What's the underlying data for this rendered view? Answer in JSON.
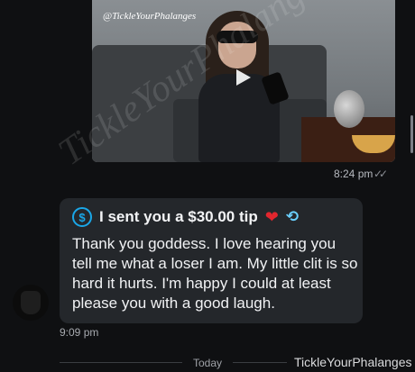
{
  "media": {
    "watermark": "@TickleYourPhalanges",
    "sent_time": "8:24 pm",
    "read_status": "✓✓"
  },
  "message": {
    "tip_text": "I sent you a $30.00 tip",
    "tip_icon": "dollar-circle-icon",
    "body": "Thank you goddess. I love hearing you tell me what a loser I am. My little clit is so hard it hurts. I'm happy I could at least please you with a good laugh.",
    "time": "9:09 pm"
  },
  "divider": {
    "label": "Today"
  },
  "footer": {
    "watermark": "TickleYourPhalanges"
  },
  "colors": {
    "background": "#0f1012",
    "bubble": "#24272b",
    "accent": "#1aa7e8",
    "heart": "#e2262e"
  }
}
